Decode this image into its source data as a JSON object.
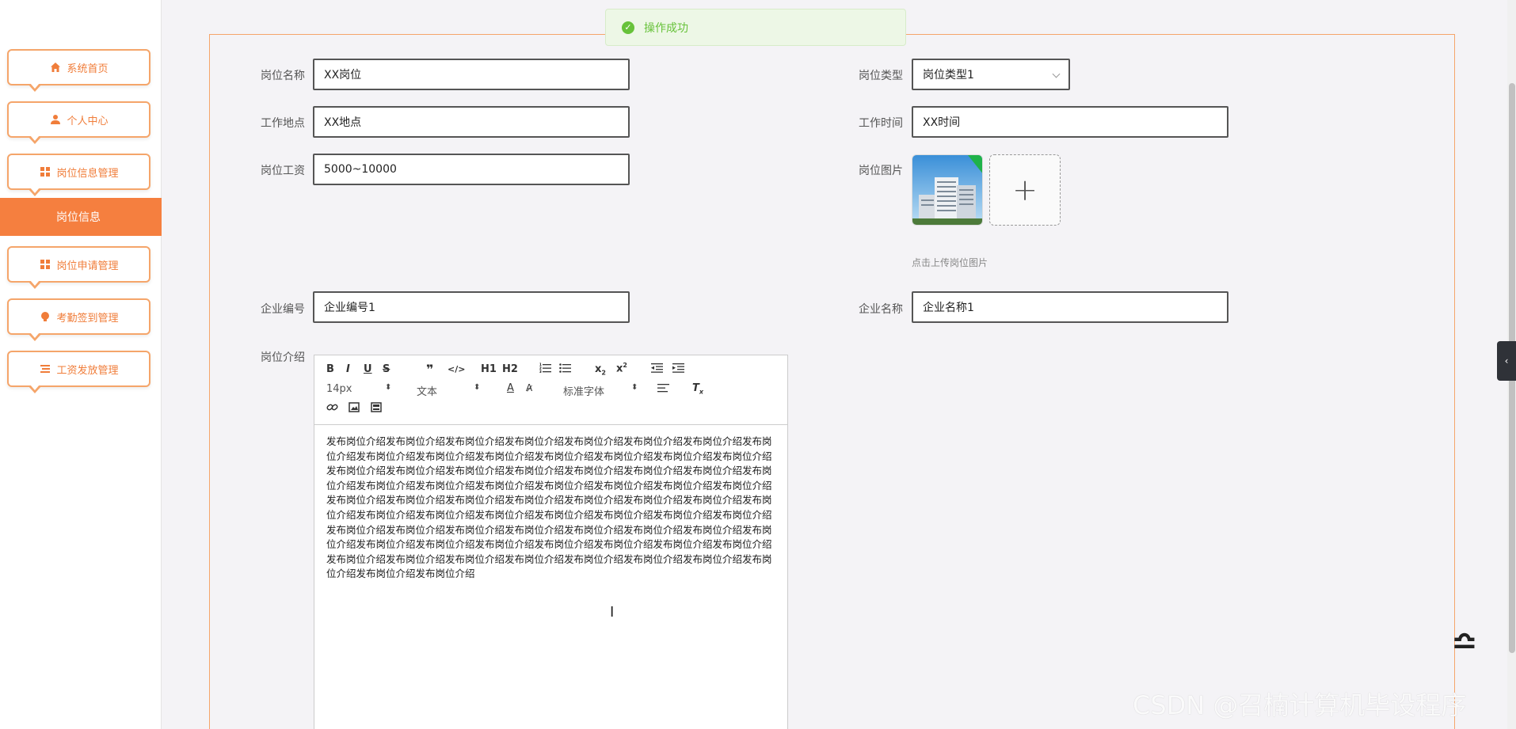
{
  "sidebar": {
    "items": [
      {
        "label": "系统首页",
        "icon": "home-icon"
      },
      {
        "label": "个人中心",
        "icon": "user-icon"
      },
      {
        "label": "岗位信息管理",
        "icon": "grid-icon"
      },
      {
        "label": "岗位申请管理",
        "icon": "grid-icon"
      },
      {
        "label": "考勤签到管理",
        "icon": "bulb-icon"
      },
      {
        "label": "工资发放管理",
        "icon": "list-icon"
      }
    ],
    "active_sub": "岗位信息"
  },
  "toast": {
    "message": "操作成功",
    "icon": "success-check-icon"
  },
  "form": {
    "job_name": {
      "label": "岗位名称",
      "value": "XX岗位"
    },
    "job_type": {
      "label": "岗位类型",
      "value": "岗位类型1"
    },
    "location": {
      "label": "工作地点",
      "value": "XX地点"
    },
    "work_time": {
      "label": "工作时间",
      "value": "XX时间"
    },
    "salary": {
      "label": "岗位工资",
      "value": "5000~10000"
    },
    "image": {
      "label": "岗位图片",
      "hint": "点击上传岗位图片",
      "add_icon": "plus-icon"
    },
    "company_no": {
      "label": "企业编号",
      "value": "企业编号1"
    },
    "company_name": {
      "label": "企业名称",
      "value": "企业名称1"
    },
    "intro": {
      "label": "岗位介绍",
      "toolbar": {
        "font_size": "14px",
        "block_type": "文本",
        "font_family": "标准字体",
        "h1": "H1",
        "h2": "H2"
      },
      "content": "发布岗位介绍发布岗位介绍发布岗位介绍发布岗位介绍发布岗位介绍发布岗位介绍发布岗位介绍发布岗位介绍发布岗位介绍发布岗位介绍发布岗位介绍发布岗位介绍发布岗位介绍发布岗位介绍发布岗位介绍发布岗位介绍发布岗位介绍发布岗位介绍发布岗位介绍发布岗位介绍发布岗位介绍发布岗位介绍发布岗位介绍发布岗位介绍发布岗位介绍发布岗位介绍发布岗位介绍发布岗位介绍发布岗位介绍发布岗位介绍发布岗位介绍发布岗位介绍发布岗位介绍发布岗位介绍发布岗位介绍发布岗位介绍发布岗位介绍发布岗位介绍发布岗位介绍发布岗位介绍发布岗位介绍发布岗位介绍发布岗位介绍发布岗位介绍发布岗位介绍发布岗位介绍发布岗位介绍发布岗位介绍发布岗位介绍发布岗位介绍发布岗位介绍发布岗位介绍发布岗位介绍发布岗位介绍发布岗位介绍发布岗位介绍发布岗位介绍发布岗位介绍发布岗位介绍发布岗位介绍发布岗位介绍发布岗位介绍发布岗位介绍发布岗位介绍发布岗位介绍发布岗位介绍发布岗位介绍发布岗位介绍发布岗位介绍发布岗位介绍"
    }
  },
  "watermark": "CSDN @召楠计算机毕设程序",
  "colors": {
    "accent": "#f57f3f",
    "border_accent": "#f5a56a",
    "success": "#67c23a"
  }
}
